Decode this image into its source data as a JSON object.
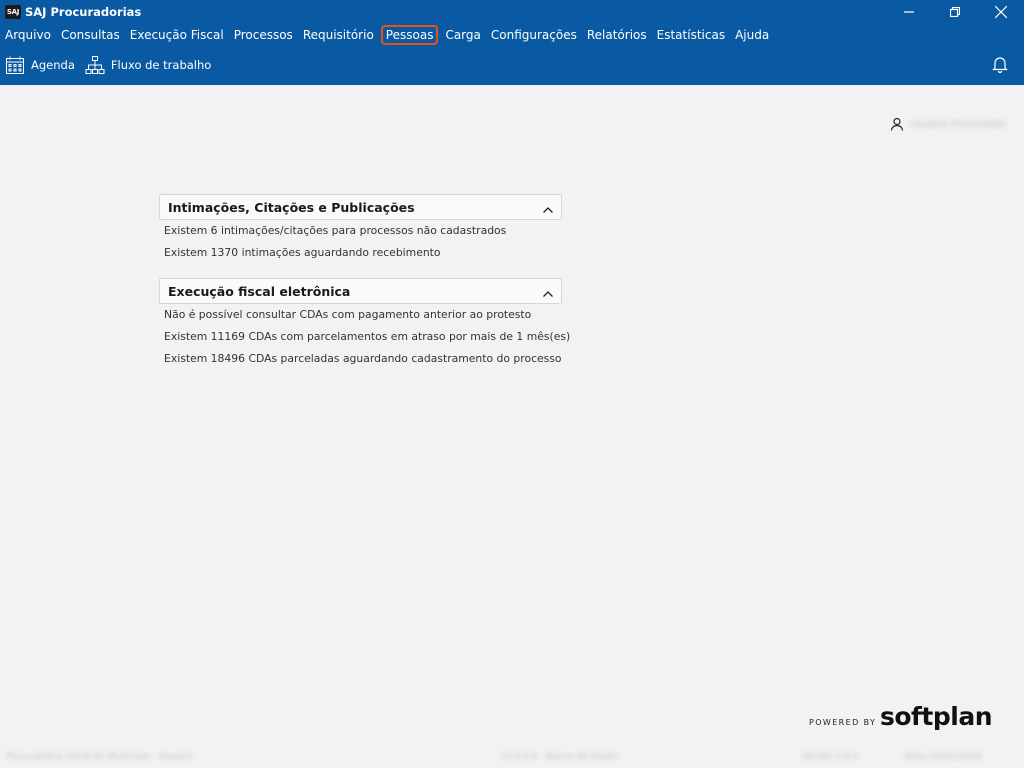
{
  "window": {
    "app_logo_text": "SAJ",
    "title": "SAJ Procuradorias"
  },
  "menu": {
    "items": [
      {
        "label": "Arquivo"
      },
      {
        "label": "Consultas"
      },
      {
        "label": "Execução Fiscal"
      },
      {
        "label": "Processos"
      },
      {
        "label": "Requisitório"
      },
      {
        "label": "Pessoas",
        "highlighted": true
      },
      {
        "label": "Carga"
      },
      {
        "label": "Configurações"
      },
      {
        "label": "Relatórios"
      },
      {
        "label": "Estatísticas"
      },
      {
        "label": "Ajuda"
      }
    ],
    "highlight_color": "#e8501a"
  },
  "toolbar": {
    "agenda_label": "Agenda",
    "agenda_icon": "calendar-icon",
    "workflow_label": "Fluxo de trabalho",
    "workflow_icon": "workflow-icon",
    "notification_icon": "bell-icon"
  },
  "user": {
    "icon": "user-icon",
    "name": "Usuário Procurador"
  },
  "panels": {
    "intimacoes": {
      "title": "Intimações, Citações e Publicações",
      "rows": [
        "Existem  6 intimações/citações para processos não cadastrados",
        "Existem  1370 intimações aguardando recebimento"
      ]
    },
    "execucao": {
      "title": "Execução fiscal eletrônica",
      "rows": [
        "Não é possível consultar CDAs com pagamento anterior ao protesto",
        "Existem  11169 CDAs com parcelamentos em atraso por mais de 1 mês(es)",
        "Existem  18496 CDAs parceladas aguardando cadastramento do processo"
      ]
    }
  },
  "footer": {
    "powered_by": "POWERED BY",
    "brand": "softplan"
  },
  "statusbar": {
    "left": "Procuradoria Geral do Município - Usuário",
    "center": "10.0.0.0 - Banco de Dados",
    "right1": "Versão 1.0.0",
    "right2": "Data 01/01/2024"
  },
  "colors": {
    "header_blue": "#0a5aa3",
    "background": "#f2f2f2"
  }
}
